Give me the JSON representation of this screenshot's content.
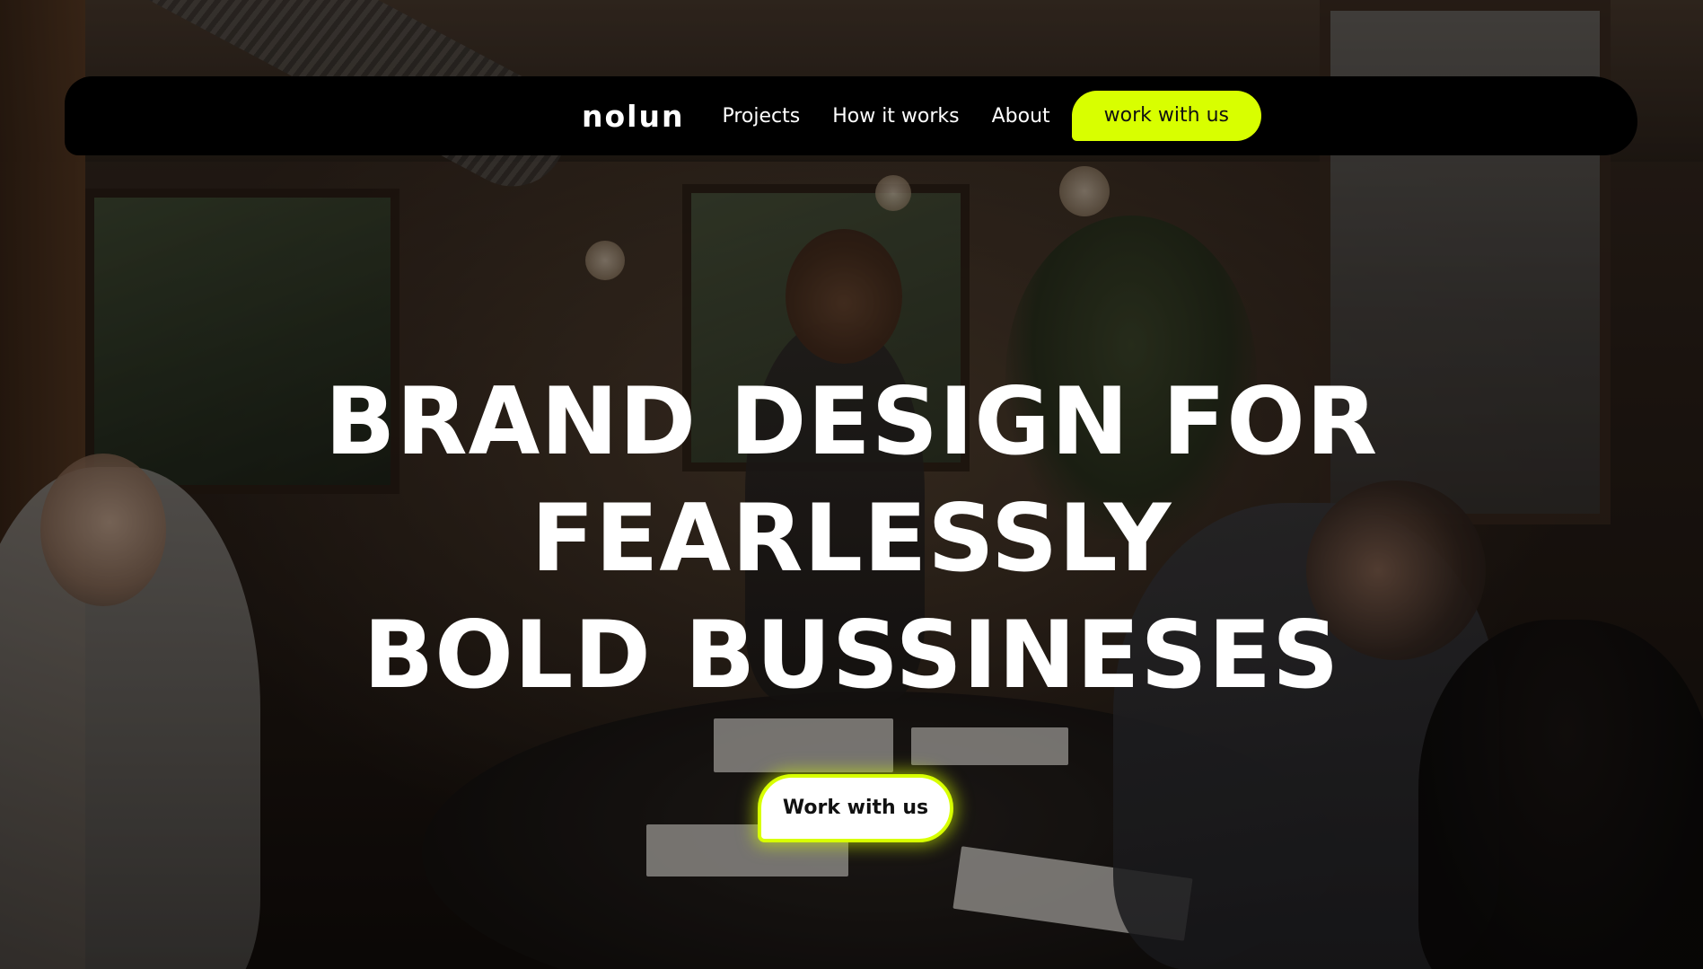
{
  "nav": {
    "logo": "nolun",
    "links": [
      "Projects",
      "How it works",
      "About"
    ],
    "cta_label": "work with us"
  },
  "hero": {
    "headline_lines": [
      "BRAND DESIGN FOR",
      "FEARLESSLY",
      "BOLD BUSSINESES"
    ],
    "cta_label": "Work with us"
  },
  "colors": {
    "accent": "#d8ff00",
    "nav_bg": "#000000",
    "text": "#ffffff"
  }
}
